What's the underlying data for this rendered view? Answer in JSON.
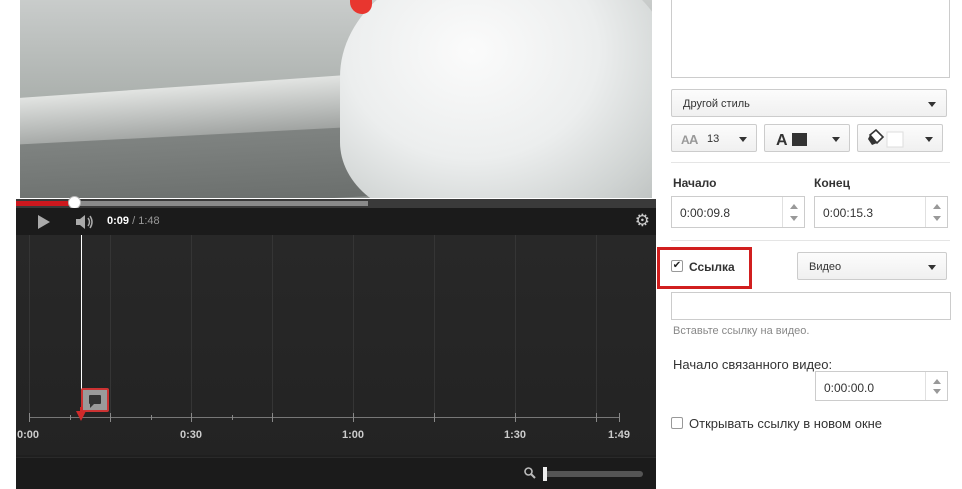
{
  "player": {
    "progress_fraction": 0.09,
    "current_time": "0:09",
    "time_separator": "/",
    "duration": "1:48"
  },
  "timeline": {
    "labels": [
      "0:00",
      "0:30",
      "1:00",
      "1:30",
      "1:49"
    ],
    "cursor_time": "0:09"
  },
  "panel": {
    "style_select": "Другой стиль",
    "font_size": "13",
    "start_label": "Начало",
    "end_label": "Конец",
    "start_value": "0:00:09.8",
    "end_value": "0:00:15.3",
    "link_label": "Ссылка",
    "link_checked": true,
    "link_type": "Видео",
    "link_url": "",
    "link_hint": "Вставьте ссылку на видео.",
    "linked_start_label": "Начало связанного видео:",
    "linked_start_value": "0:00:00.0",
    "new_window_label": "Открывать ссылку в новом окне",
    "new_window_checked": false
  },
  "colors": {
    "accent_red": "#cc181e",
    "highlight_red": "#d11f1f",
    "text_color_swatch": "#333333",
    "bg_color_swatch": "#ffffff"
  },
  "icons": [
    "play-icon",
    "volume-icon",
    "gear-icon",
    "annotation-bubble-icon",
    "zoom-icon",
    "font-size-icon",
    "text-color-icon",
    "fill-color-icon"
  ]
}
